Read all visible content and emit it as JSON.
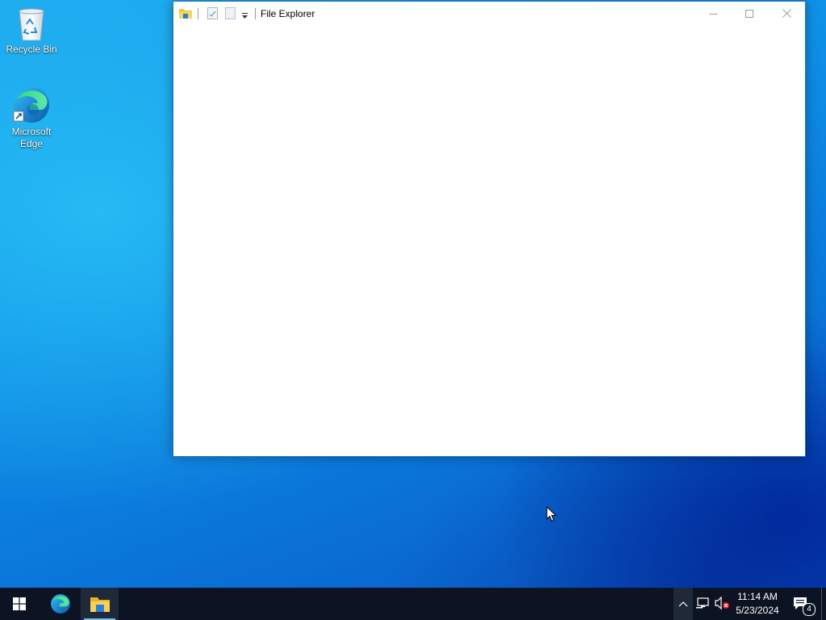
{
  "desktop": {
    "icons": [
      {
        "label": "Recycle Bin",
        "icon": "recycle-bin-icon"
      },
      {
        "label": "Microsoft Edge",
        "icon": "edge-icon"
      }
    ]
  },
  "window": {
    "title": "File Explorer",
    "quick_access": [
      "folder-icon",
      "properties-icon",
      "new-folder-icon",
      "customize-dropdown-icon"
    ],
    "controls": [
      "minimize",
      "maximize",
      "close"
    ]
  },
  "taskbar": {
    "start": "windows-logo-icon",
    "pinned": [
      {
        "name": "Microsoft Edge",
        "icon": "edge-icon"
      },
      {
        "name": "File Explorer",
        "icon": "file-explorer-icon",
        "active": true
      }
    ],
    "tray": {
      "chevron": "show-hidden-icons",
      "network": "network-icon",
      "volume": "volume-muted-icon"
    },
    "clock": {
      "time": "11:14 AM",
      "date": "5/23/2024"
    },
    "notifications": {
      "count": "4"
    }
  },
  "colors": {
    "accent": "#0a74d8",
    "taskbar": "#0c1423",
    "window_border": "#1a6fbf"
  }
}
